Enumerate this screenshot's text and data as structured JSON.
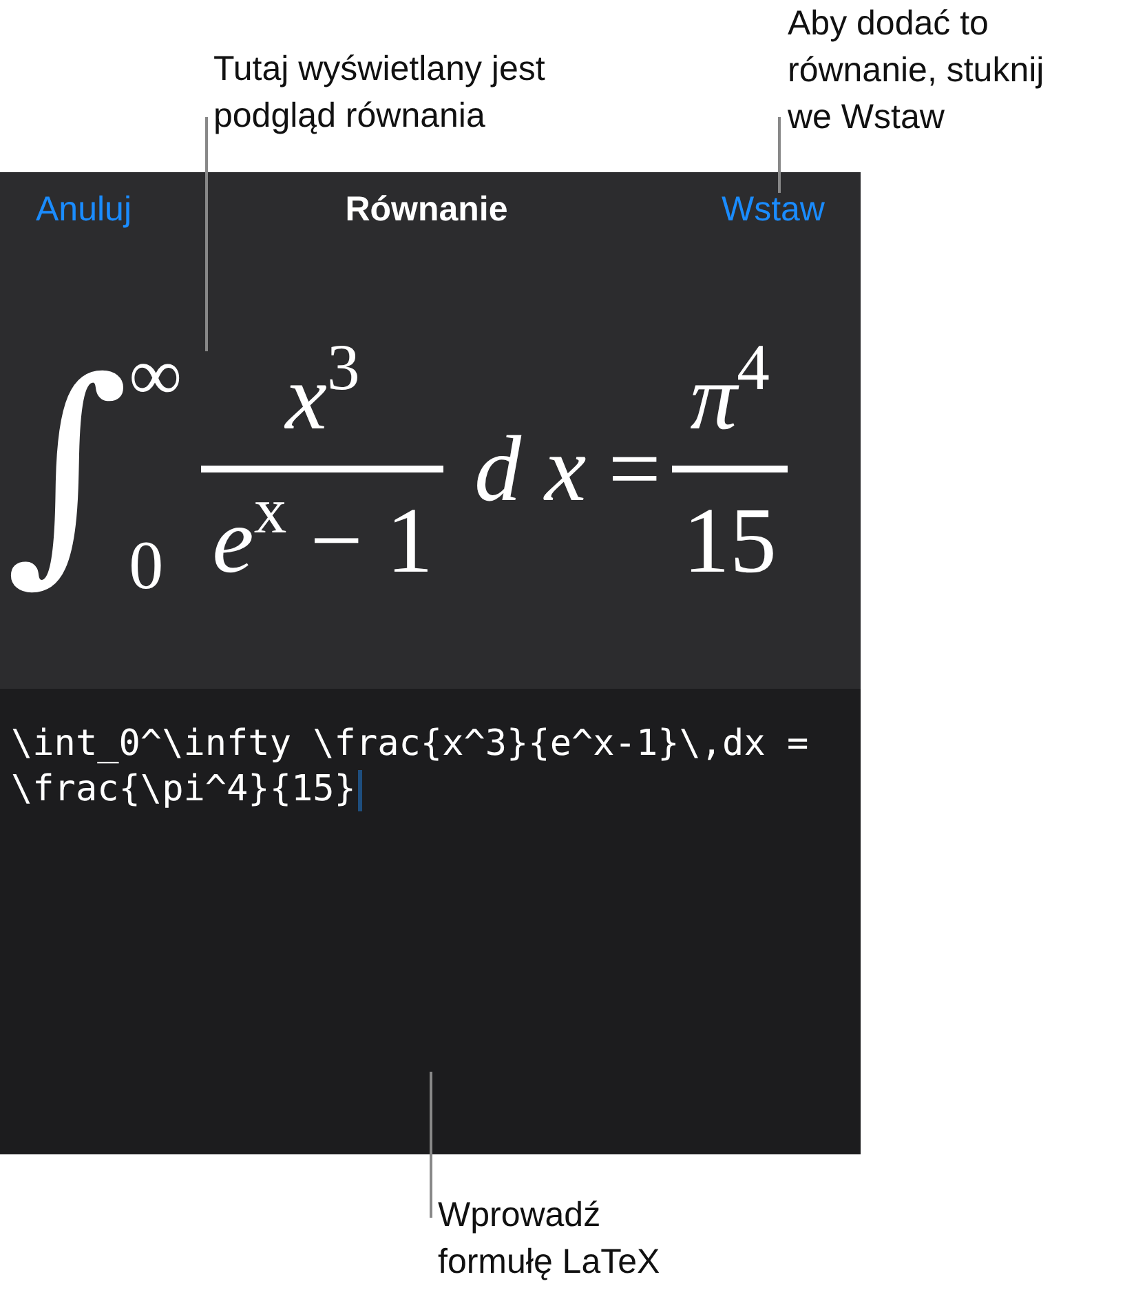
{
  "annotations": [
    {
      "text": "Tutaj wyświetlany jest podgląd równania",
      "kind": "preview"
    },
    {
      "text": "Aby dodać to równanie, stuknij we Wstaw",
      "kind": "insert"
    },
    {
      "text": "Wprowadź formułę LaTeX",
      "kind": "editor"
    }
  ],
  "dialog": {
    "cancel": "Anuluj",
    "title": "Równanie",
    "insert": "Wstaw"
  },
  "preview": {
    "integral": "∫",
    "upper": "∞",
    "lower": "0",
    "numerator": "*x*$^{3}$",
    "denominator": "*e*$^{x}$ − 1",
    "differential": "d x",
    "equals": "=",
    "rhs_numerator": "*π*$^{4}$",
    "rhs_denominator": "15"
  },
  "editor": {
    "lines": [
      "\\int_0^\\infty \\frac{x^3}{e^x-1}\\,dx =",
      "\\frac{\\pi^4}{15}"
    ]
  }
}
